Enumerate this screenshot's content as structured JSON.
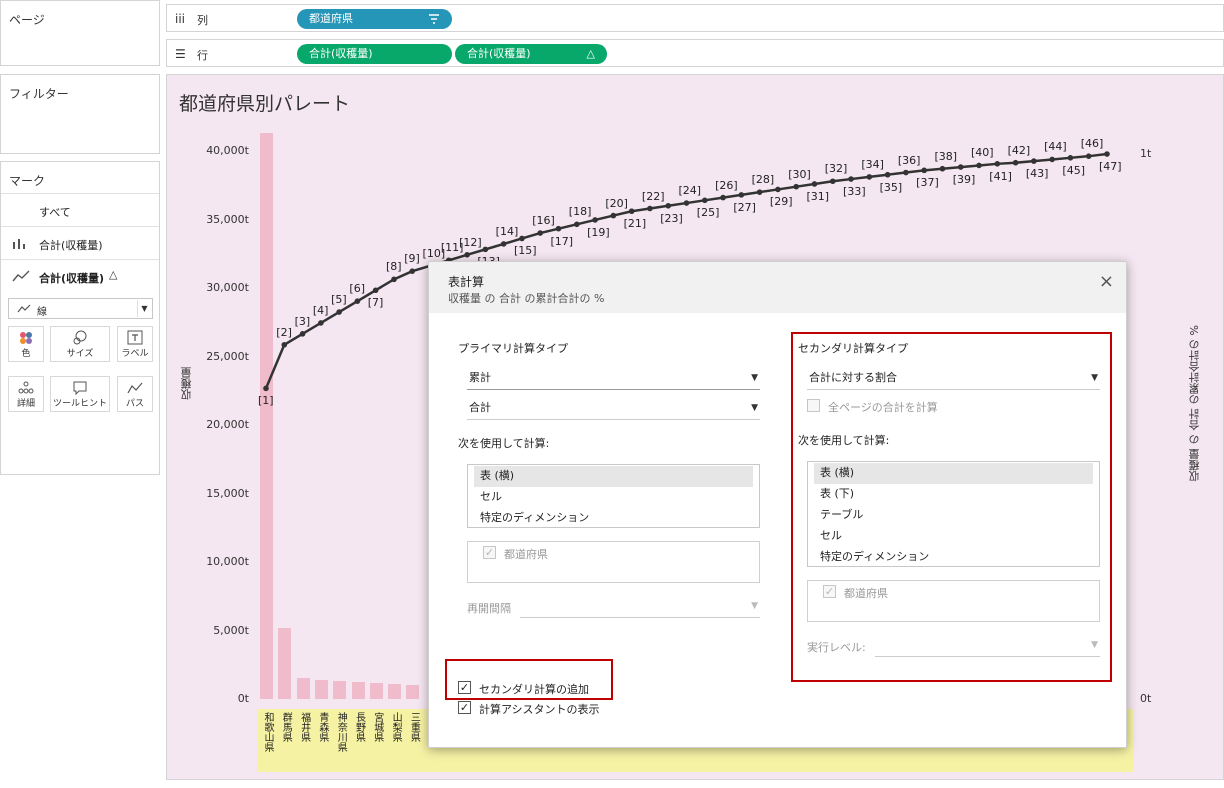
{
  "panels": {
    "pages": "ページ",
    "filters": "フィルター",
    "marks": {
      "title": "マーク",
      "all": "すべて",
      "measure1": "合計(収穫量)",
      "measure2": "合計(収穫量)",
      "delta": "△",
      "mark_type": "線",
      "cards": [
        "色",
        "サイズ",
        "ラベル",
        "詳細",
        "ツールヒント",
        "パス"
      ]
    }
  },
  "shelves": {
    "columns": {
      "label": "列",
      "pill": "都道府県"
    },
    "rows": {
      "label": "行",
      "pill1": "合計(収穫量)",
      "pill2": "合計(収穫量)",
      "delta": "△"
    }
  },
  "colors": {
    "dim_pill": "#2596b7",
    "measure_pill": "#08a86b",
    "bar": "#f0bccb",
    "line": "#333333",
    "viz_bg": "#f5e7f1",
    "highlight": "#c00000"
  },
  "chart_data": {
    "type": "bar",
    "title": "都道府県別パレート",
    "ylabel": "収穫量",
    "y2label": "収穫量 の 合計 の累計合計の %",
    "ylim": [
      0,
      42000
    ],
    "yticks": [
      "0t",
      "5,000t",
      "10,000t",
      "15,000t",
      "20,000t",
      "25,000t",
      "30,000t",
      "35,000t",
      "40,000t"
    ],
    "y2ticks": [
      "0t",
      "1t"
    ],
    "categories": [
      "和歌山県",
      "群馬県",
      "福井県",
      "青森県",
      "神奈川県",
      "長野県",
      "宮城県",
      "山梨県",
      "三重県"
    ],
    "values": [
      41300,
      5200,
      1500,
      1400,
      1300,
      1250,
      1150,
      1100,
      1050
    ],
    "line": {
      "name": "累計合計の %",
      "labels": [
        "[1]",
        "[2]",
        "[3]",
        "[4]",
        "[5]",
        "[6]",
        "[7]",
        "[8]",
        "[9]",
        "[10]",
        "[11]",
        "[12]",
        "[13]",
        "[14]",
        "[15]",
        "[16]",
        "[17]",
        "[18]",
        "[19]",
        "[20]",
        "[21]",
        "[22]",
        "[23]",
        "[24]",
        "[25]",
        "[26]",
        "[27]",
        "[28]",
        "[29]",
        "[30]",
        "[31]",
        "[32]",
        "[33]",
        "[34]",
        "[35]",
        "[36]",
        "[37]",
        "[38]",
        "[39]",
        "[40]",
        "[41]",
        "[42]",
        "[43]",
        "[44]",
        "[45]",
        "[46]",
        "[47]"
      ],
      "values": [
        0.57,
        0.65,
        0.67,
        0.69,
        0.71,
        0.73,
        0.75,
        0.77,
        0.785,
        0.795,
        0.805,
        0.815,
        0.825,
        0.835,
        0.845,
        0.855,
        0.863,
        0.871,
        0.879,
        0.887,
        0.895,
        0.9,
        0.905,
        0.91,
        0.915,
        0.92,
        0.925,
        0.93,
        0.935,
        0.94,
        0.945,
        0.95,
        0.954,
        0.958,
        0.962,
        0.966,
        0.97,
        0.973,
        0.976,
        0.979,
        0.982,
        0.984,
        0.987,
        0.99,
        0.993,
        0.996,
        1.0
      ]
    }
  },
  "dialog": {
    "title": "表計算",
    "subtitle": "収穫量 の 合計 の累計合計の %",
    "close": "×",
    "primary": {
      "title": "プライマリ計算タイプ",
      "calc_type": "累計",
      "aggregation": "合計",
      "compute_using": "次を使用して計算:",
      "options": [
        "表 (横)",
        "セル",
        "特定のディメンション"
      ],
      "dimension": "都道府県",
      "restart": "再開間隔"
    },
    "secondary": {
      "title": "セカンダリ計算タイプ",
      "calc_type": "合計に対する割合",
      "all_pages": "全ページの合計を計算",
      "compute_using": "次を使用して計算:",
      "options": [
        "表 (横)",
        "表 (下)",
        "テーブル",
        "セル",
        "特定のディメンション"
      ],
      "dimension": "都道府県",
      "level": "実行レベル:"
    },
    "add_secondary": "セカンダリ計算の追加",
    "show_assistant": "計算アシスタントの表示",
    "check": "✓"
  }
}
